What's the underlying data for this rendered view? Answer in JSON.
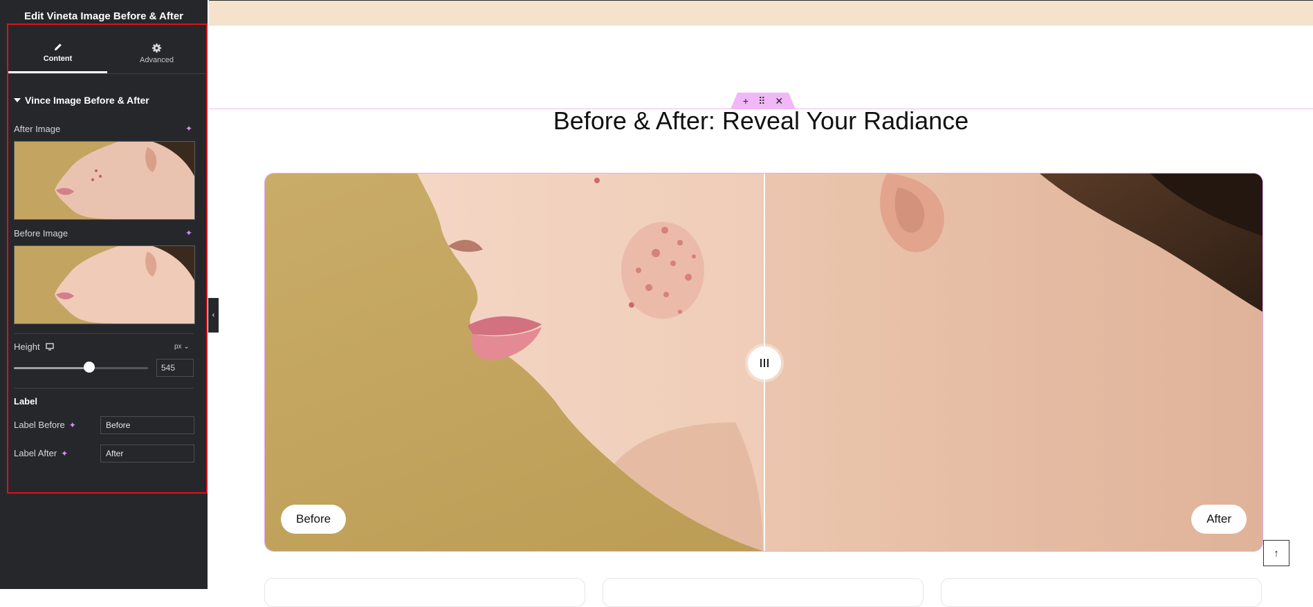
{
  "panel": {
    "title": "Edit Vineta Image Before & After",
    "tabs": [
      {
        "label": "Content",
        "icon": "pencil-icon",
        "active": true
      },
      {
        "label": "Advanced",
        "icon": "gear-icon",
        "active": false
      }
    ],
    "section_title": "Vince Image Before & After",
    "after_image": {
      "label": "After Image",
      "icon": "ai-sparkle-icon"
    },
    "before_image": {
      "label": "Before Image",
      "icon": "ai-sparkle-icon"
    },
    "height": {
      "label": "Height",
      "device_icon": "desktop-icon",
      "unit": "px",
      "value": "545",
      "slider_fraction": 0.56
    },
    "label_section": {
      "heading": "Label",
      "label_before": {
        "label": "Label Before",
        "value": "Before"
      },
      "label_after": {
        "label": "Label After",
        "value": "After"
      }
    }
  },
  "canvas": {
    "section_handle": {
      "add": "+",
      "move": "⠿",
      "close": "✕"
    },
    "heading": "Before & After: Reveal Your Radiance",
    "comparison": {
      "before_label": "Before",
      "after_label": "After",
      "divider_position": 0.5
    },
    "scroll_top_icon": "↑"
  },
  "colors": {
    "panel_bg": "#26272b",
    "accent_magenta": "#f0b8f7",
    "highlight_red": "#e0101a",
    "top_band": "#f4e2cd",
    "photo_background": "#c6a862"
  }
}
